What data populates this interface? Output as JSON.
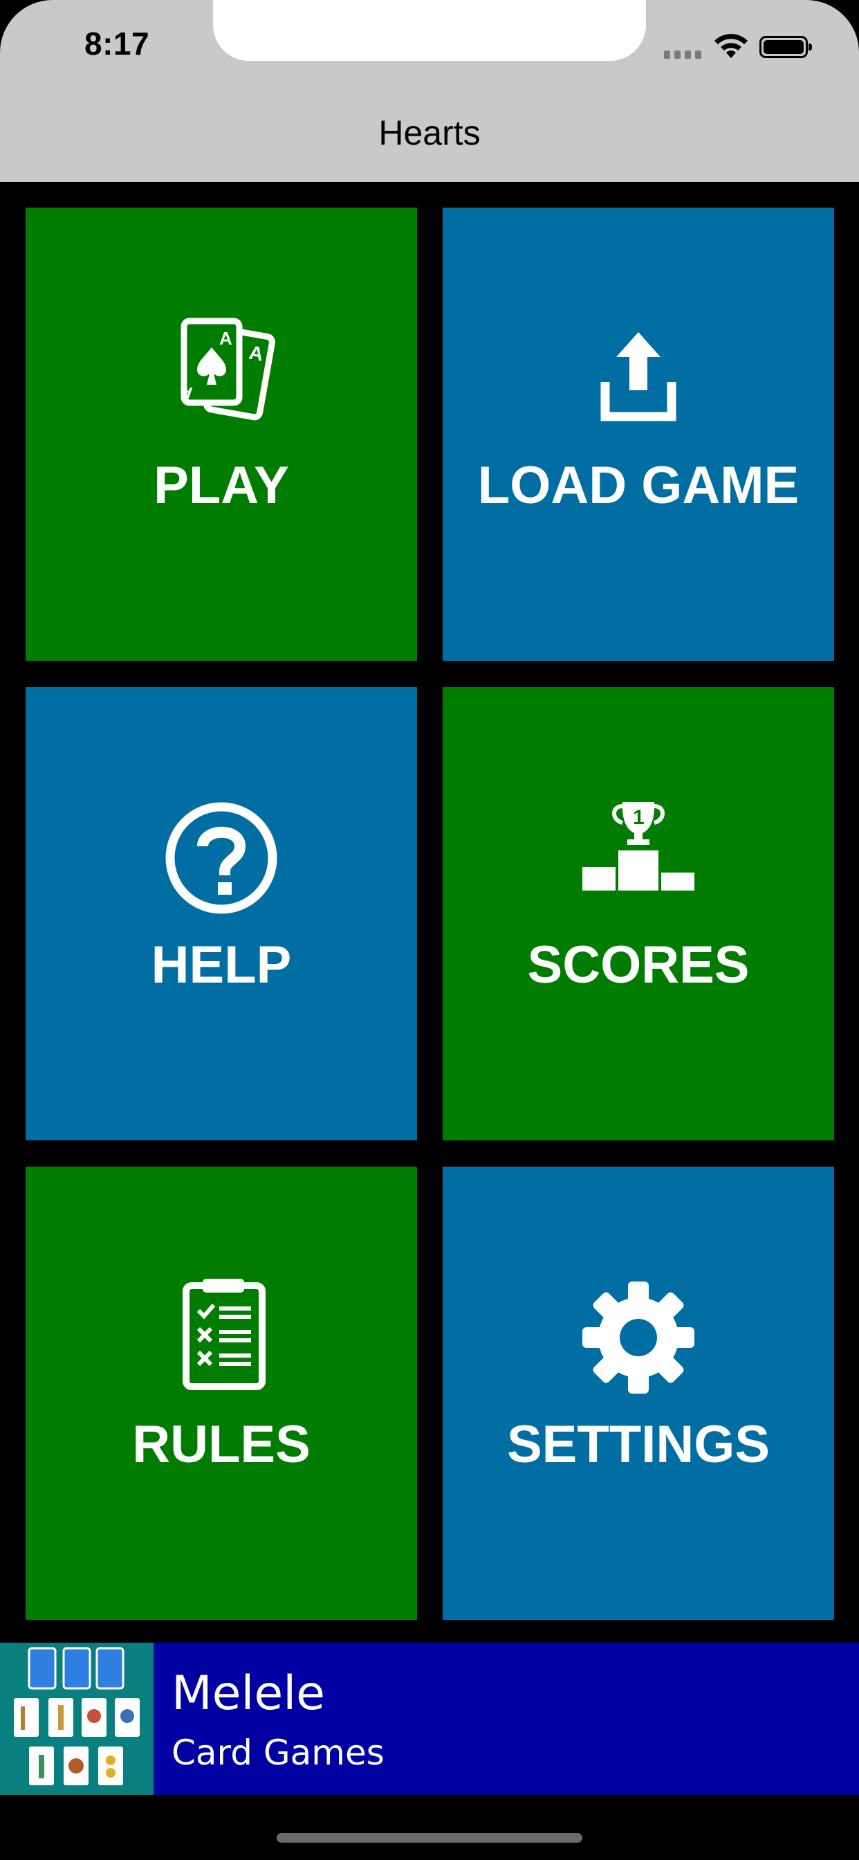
{
  "status_bar": {
    "time": "8:17"
  },
  "nav": {
    "title": "Hearts"
  },
  "menu": {
    "play": {
      "label": "PLAY",
      "icon": "playing-cards-icon"
    },
    "load_game": {
      "label": "LOAD GAME",
      "icon": "upload-icon"
    },
    "help": {
      "label": "HELP",
      "icon": "question-circle-icon"
    },
    "scores": {
      "label": "SCORES",
      "icon": "podium-trophy-icon"
    },
    "rules": {
      "label": "RULES",
      "icon": "clipboard-checklist-icon"
    },
    "settings": {
      "label": "SETTINGS",
      "icon": "gear-icon"
    }
  },
  "ad": {
    "title": "Melele",
    "subtitle": "Card Games"
  },
  "colors": {
    "green": "#007d00",
    "blue": "#006ea3",
    "ad_bg": "#0000a2",
    "bar_bg": "#c9c9c9"
  }
}
